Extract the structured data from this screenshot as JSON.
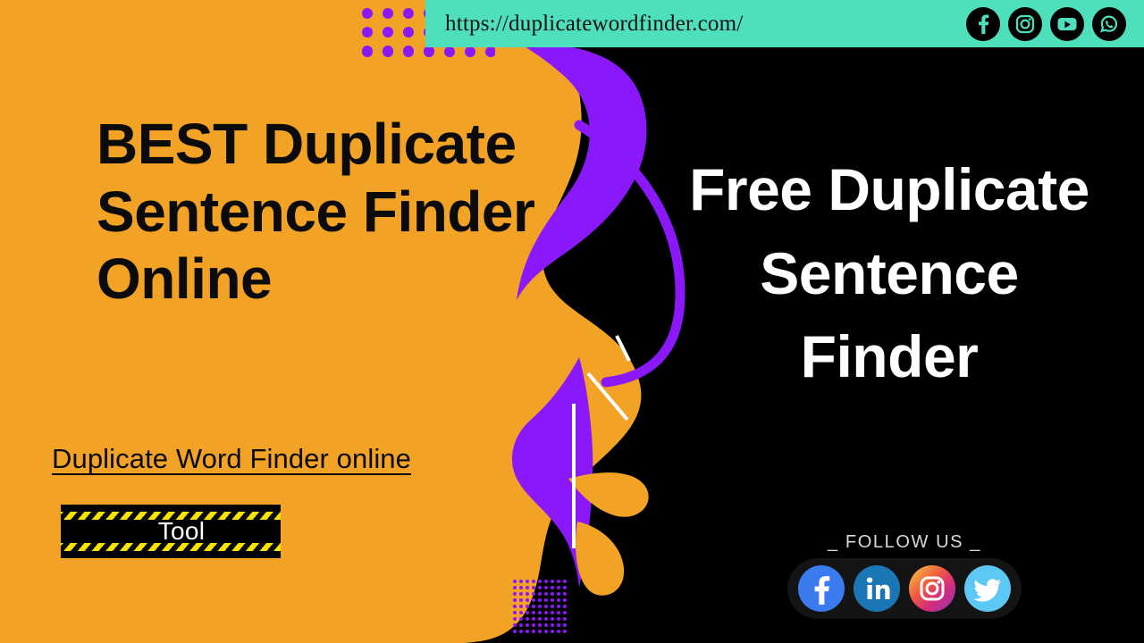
{
  "url_bar": {
    "url": "https://duplicatewordfinder.com/",
    "background_color": "#4ee0bc",
    "socials": [
      {
        "name": "facebook",
        "label": "Facebook"
      },
      {
        "name": "instagram",
        "label": "Instagram"
      },
      {
        "name": "youtube",
        "label": "YouTube"
      },
      {
        "name": "whatsapp",
        "label": "WhatsApp"
      }
    ]
  },
  "left_panel": {
    "background_color": "#f2a224",
    "headline": "BEST Duplicate Sentence Finder Online",
    "link_text": "Duplicate Word Finder online",
    "button_label": "Tool",
    "button_bg": "#000000",
    "hazard_color": "#f7e400"
  },
  "right_panel": {
    "background_color": "#000000",
    "headline": "Free Duplicate Sentence Finder",
    "follow_label": "_ FOLLOW US _",
    "socials": [
      {
        "name": "facebook",
        "label": "Facebook",
        "color": "#3b7bf0"
      },
      {
        "name": "linkedin",
        "label": "LinkedIn",
        "color": "#1b76b5"
      },
      {
        "name": "instagram",
        "label": "Instagram",
        "color": "#d62a7e"
      },
      {
        "name": "twitter",
        "label": "Twitter",
        "color": "#5ec8f5"
      }
    ]
  },
  "decorations": {
    "purple_color": "#8b18fa",
    "accent_white": "#ffffff",
    "dot_color": "#8b18fa"
  }
}
